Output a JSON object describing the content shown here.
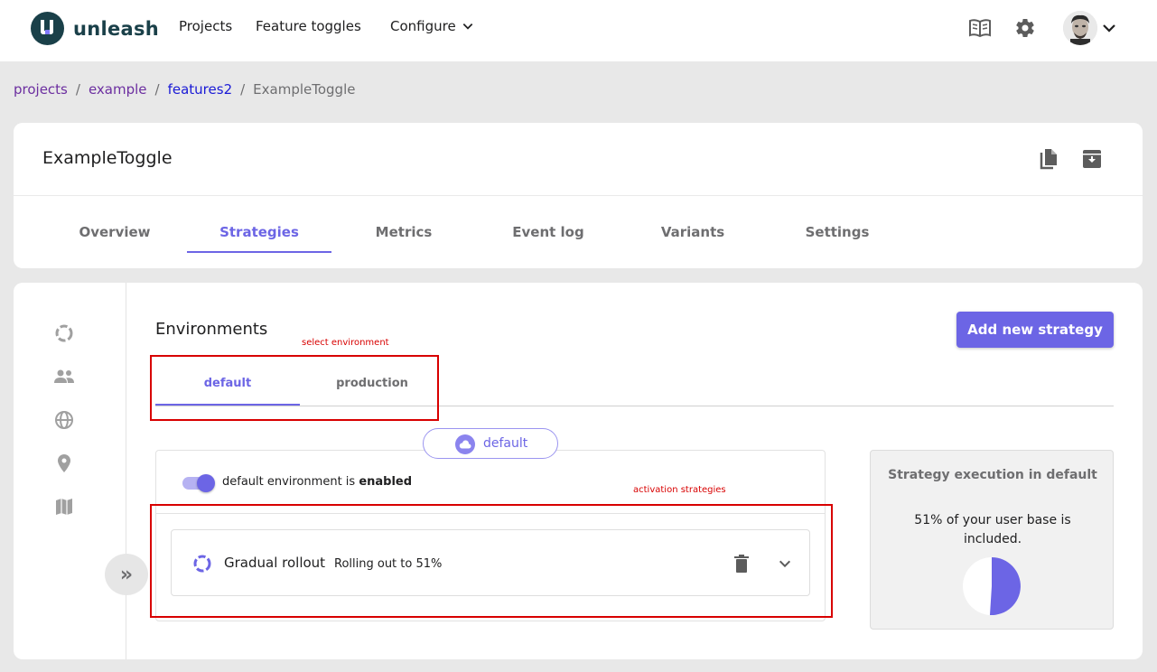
{
  "header": {
    "logo_text": "unleash",
    "nav": [
      "Projects",
      "Feature toggles",
      "Configure"
    ]
  },
  "breadcrumb": {
    "items": [
      "projects",
      "example",
      "features2"
    ],
    "current": "ExampleToggle",
    "separator": "/"
  },
  "feature": {
    "title": "ExampleToggle",
    "tabs": [
      "Overview",
      "Strategies",
      "Metrics",
      "Event log",
      "Variants",
      "Settings"
    ],
    "active_tab": "Strategies"
  },
  "strategies_page": {
    "environments_title": "Environments",
    "add_button": "Add new strategy",
    "env_tabs": [
      "default",
      "production"
    ],
    "active_env": "default",
    "env_badge": "default",
    "env_status_prefix": "default environment is",
    "env_status_value": "enabled",
    "strategy": {
      "name": "Gradual rollout",
      "description": "Rolling out to 51%"
    }
  },
  "annotations": {
    "select_environment": "select environment",
    "activation_strategies": "activation strategies"
  },
  "execution": {
    "title": "Strategy execution in default",
    "text": "51% of your user base is included.",
    "percent": 51
  },
  "colors": {
    "accent": "#6c65e5",
    "brand": "#1a4049",
    "annotation": "#d80000"
  }
}
